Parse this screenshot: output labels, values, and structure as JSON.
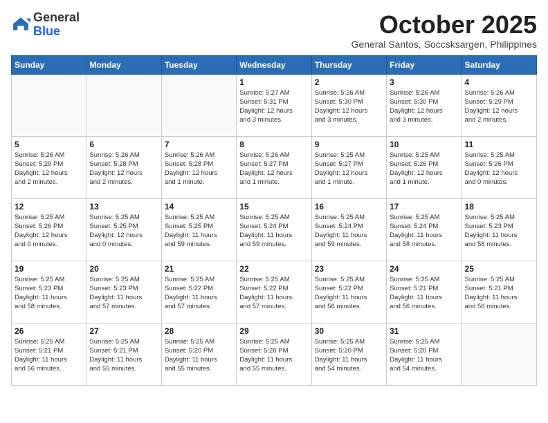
{
  "header": {
    "logo_general": "General",
    "logo_blue": "Blue",
    "month_title": "October 2025",
    "subtitle": "General Santos, Soccsksargen, Philippines"
  },
  "days_of_week": [
    "Sunday",
    "Monday",
    "Tuesday",
    "Wednesday",
    "Thursday",
    "Friday",
    "Saturday"
  ],
  "weeks": [
    [
      {
        "day": "",
        "info": ""
      },
      {
        "day": "",
        "info": ""
      },
      {
        "day": "",
        "info": ""
      },
      {
        "day": "1",
        "info": "Sunrise: 5:27 AM\nSunset: 5:31 PM\nDaylight: 12 hours\nand 3 minutes."
      },
      {
        "day": "2",
        "info": "Sunrise: 5:26 AM\nSunset: 5:30 PM\nDaylight: 12 hours\nand 3 minutes."
      },
      {
        "day": "3",
        "info": "Sunrise: 5:26 AM\nSunset: 5:30 PM\nDaylight: 12 hours\nand 3 minutes."
      },
      {
        "day": "4",
        "info": "Sunrise: 5:26 AM\nSunset: 5:29 PM\nDaylight: 12 hours\nand 2 minutes."
      }
    ],
    [
      {
        "day": "5",
        "info": "Sunrise: 5:26 AM\nSunset: 5:29 PM\nDaylight: 12 hours\nand 2 minutes."
      },
      {
        "day": "6",
        "info": "Sunrise: 5:26 AM\nSunset: 5:28 PM\nDaylight: 12 hours\nand 2 minutes."
      },
      {
        "day": "7",
        "info": "Sunrise: 5:26 AM\nSunset: 5:28 PM\nDaylight: 12 hours\nand 1 minute."
      },
      {
        "day": "8",
        "info": "Sunrise: 5:26 AM\nSunset: 5:27 PM\nDaylight: 12 hours\nand 1 minute."
      },
      {
        "day": "9",
        "info": "Sunrise: 5:25 AM\nSunset: 5:27 PM\nDaylight: 12 hours\nand 1 minute."
      },
      {
        "day": "10",
        "info": "Sunrise: 5:25 AM\nSunset: 5:26 PM\nDaylight: 12 hours\nand 1 minute."
      },
      {
        "day": "11",
        "info": "Sunrise: 5:25 AM\nSunset: 5:26 PM\nDaylight: 12 hours\nand 0 minutes."
      }
    ],
    [
      {
        "day": "12",
        "info": "Sunrise: 5:25 AM\nSunset: 5:26 PM\nDaylight: 12 hours\nand 0 minutes."
      },
      {
        "day": "13",
        "info": "Sunrise: 5:25 AM\nSunset: 5:25 PM\nDaylight: 12 hours\nand 0 minutes."
      },
      {
        "day": "14",
        "info": "Sunrise: 5:25 AM\nSunset: 5:25 PM\nDaylight: 11 hours\nand 59 minutes."
      },
      {
        "day": "15",
        "info": "Sunrise: 5:25 AM\nSunset: 5:24 PM\nDaylight: 11 hours\nand 59 minutes."
      },
      {
        "day": "16",
        "info": "Sunrise: 5:25 AM\nSunset: 5:24 PM\nDaylight: 11 hours\nand 59 minutes."
      },
      {
        "day": "17",
        "info": "Sunrise: 5:25 AM\nSunset: 5:24 PM\nDaylight: 11 hours\nand 58 minutes."
      },
      {
        "day": "18",
        "info": "Sunrise: 5:25 AM\nSunset: 5:23 PM\nDaylight: 11 hours\nand 58 minutes."
      }
    ],
    [
      {
        "day": "19",
        "info": "Sunrise: 5:25 AM\nSunset: 5:23 PM\nDaylight: 11 hours\nand 58 minutes."
      },
      {
        "day": "20",
        "info": "Sunrise: 5:25 AM\nSunset: 5:23 PM\nDaylight: 11 hours\nand 57 minutes."
      },
      {
        "day": "21",
        "info": "Sunrise: 5:25 AM\nSunset: 5:22 PM\nDaylight: 11 hours\nand 57 minutes."
      },
      {
        "day": "22",
        "info": "Sunrise: 5:25 AM\nSunset: 5:22 PM\nDaylight: 11 hours\nand 57 minutes."
      },
      {
        "day": "23",
        "info": "Sunrise: 5:25 AM\nSunset: 5:22 PM\nDaylight: 11 hours\nand 56 minutes."
      },
      {
        "day": "24",
        "info": "Sunrise: 5:25 AM\nSunset: 5:21 PM\nDaylight: 11 hours\nand 56 minutes."
      },
      {
        "day": "25",
        "info": "Sunrise: 5:25 AM\nSunset: 5:21 PM\nDaylight: 11 hours\nand 56 minutes."
      }
    ],
    [
      {
        "day": "26",
        "info": "Sunrise: 5:25 AM\nSunset: 5:21 PM\nDaylight: 11 hours\nand 56 minutes."
      },
      {
        "day": "27",
        "info": "Sunrise: 5:25 AM\nSunset: 5:21 PM\nDaylight: 11 hours\nand 55 minutes."
      },
      {
        "day": "28",
        "info": "Sunrise: 5:25 AM\nSunset: 5:20 PM\nDaylight: 11 hours\nand 55 minutes."
      },
      {
        "day": "29",
        "info": "Sunrise: 5:25 AM\nSunset: 5:20 PM\nDaylight: 11 hours\nand 55 minutes."
      },
      {
        "day": "30",
        "info": "Sunrise: 5:25 AM\nSunset: 5:20 PM\nDaylight: 11 hours\nand 54 minutes."
      },
      {
        "day": "31",
        "info": "Sunrise: 5:25 AM\nSunset: 5:20 PM\nDaylight: 11 hours\nand 54 minutes."
      },
      {
        "day": "",
        "info": ""
      }
    ]
  ]
}
